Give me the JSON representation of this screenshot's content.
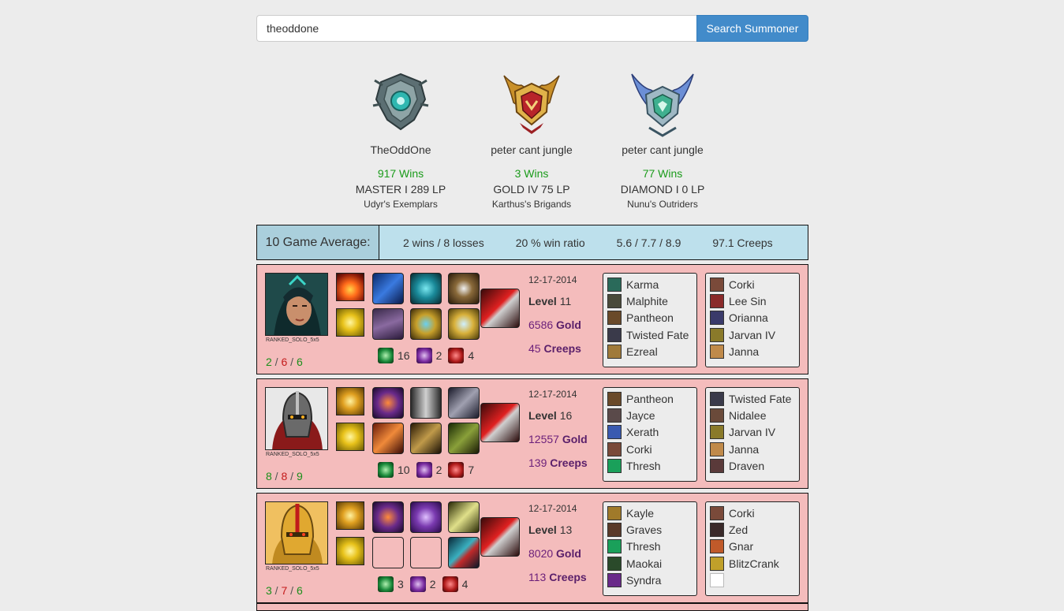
{
  "search": {
    "value": "theoddone",
    "button_label": "Search Summoner"
  },
  "leagues": [
    {
      "name": "TheOddOne",
      "wins": "917 Wins",
      "tier": "MASTER I 289 LP",
      "division": "Udyr's Exemplars",
      "emblem": "master-emblem-icon"
    },
    {
      "name": "peter cant jungle",
      "wins": "3 Wins",
      "tier": "GOLD IV 75 LP",
      "division": "Karthus's Brigands",
      "emblem": "gold-emblem-icon"
    },
    {
      "name": "peter cant jungle",
      "wins": "77 Wins",
      "tier": "DIAMOND I 0 LP",
      "division": "Nunu's Outriders",
      "emblem": "diamond-emblem-icon"
    }
  ],
  "average": {
    "label": "10 Game Average:",
    "record": "2 wins / 8 losses",
    "win_ratio": "20 % win ratio",
    "kda": "5.6 / 7.7 / 8.9",
    "creeps": "97.1 Creeps"
  },
  "colors": {
    "accent": "#428bca",
    "loss_background": "#f4bcbc",
    "average_background": "#bde0ec",
    "wins_green": "#1a9b1a",
    "deaths_red": "#c41a1a",
    "stat_purple": "#6b1f7a"
  },
  "games": [
    {
      "champion": "karma-portrait",
      "queue": "RANKED_SOLO_5x5",
      "kills": "2",
      "deaths": "6",
      "assists": "6",
      "date": "12-17-2014",
      "level_label": "Level",
      "level": "11",
      "gold": "6586",
      "gold_label": "Gold",
      "creeps": "45",
      "creeps_label": "Creeps",
      "wards": [
        "16",
        "2",
        "4"
      ],
      "team1": [
        "Karma",
        "Malphite",
        "Pantheon",
        "Twisted Fate",
        "Ezreal"
      ],
      "team2": [
        "Corki",
        "Lee Sin",
        "Orianna",
        "Jarvan IV",
        "Janna"
      ]
    },
    {
      "champion": "pantheon-portrait",
      "queue": "RANKED_SOLO_5x5",
      "kills": "8",
      "deaths": "8",
      "assists": "9",
      "date": "12-17-2014",
      "level_label": "Level",
      "level": "16",
      "gold": "12557",
      "gold_label": "Gold",
      "creeps": "139",
      "creeps_label": "Creeps",
      "wards": [
        "10",
        "2",
        "7"
      ],
      "team1": [
        "Pantheon",
        "Jayce",
        "Xerath",
        "Corki",
        "Thresh"
      ],
      "team2": [
        "Twisted Fate",
        "Nidalee",
        "Jarvan IV",
        "Janna",
        "Draven"
      ]
    },
    {
      "champion": "pantheon-portrait",
      "queue": "RANKED_SOLO_5x5",
      "kills": "3",
      "deaths": "7",
      "assists": "6",
      "date": "12-17-2014",
      "level_label": "Level",
      "level": "13",
      "gold": "8020",
      "gold_label": "Gold",
      "creeps": "113",
      "creeps_label": "Creeps",
      "wards": [
        "3",
        "2",
        "4"
      ],
      "team1": [
        "Kayle",
        "Graves",
        "Thresh",
        "Maokai",
        "Syndra"
      ],
      "team2": [
        "Corki",
        "Zed",
        "Gnar",
        "BlitzCrank",
        ""
      ]
    }
  ]
}
